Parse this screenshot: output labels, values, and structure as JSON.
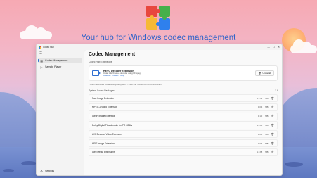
{
  "hero": {
    "title": "Your hub for Windows codec management"
  },
  "window": {
    "app_name": "Codec Hub",
    "controls": [
      "—",
      "☐",
      "✕"
    ]
  },
  "sidebar": {
    "items": [
      {
        "label": "Codec Management",
        "icon": "grid-icon",
        "active": true
      },
      {
        "label": "Sample Player",
        "icon": "play-icon",
        "active": false
      }
    ],
    "settings_label": "Settings"
  },
  "main": {
    "title": "Codec Management",
    "installed_label": "Codec Hub Extensions",
    "extension": {
      "name": "HEVC Decoder Extension",
      "desc": "Install HEVC video decoder using FFmpeg",
      "links": [
        "Available",
        "Details",
        "Help"
      ],
      "button_label": "Uninstall"
    },
    "note": "These codecs are installed on your system — click the TRASH icon to remove them",
    "system_label": "System Codec Packages",
    "codecs": [
      {
        "name": "Raw Image Extension",
        "version": "2.1.32",
        "size": "MB"
      },
      {
        "name": "MPEG-2 Video Extension",
        "version": "1.0.4",
        "size": "MB"
      },
      {
        "name": "WebP Image Extension",
        "version": "1.1.0",
        "size": "MB"
      },
      {
        "name": "Dolby Digital Plus decoder for PC OEMs",
        "version": "1.0.88",
        "size": "MB"
      },
      {
        "name": "AV1 Decoder Video Extension",
        "version": "1.2.0",
        "size": "MB"
      },
      {
        "name": "HEIF Image Extension",
        "version": "1.0.6",
        "size": "MB"
      },
      {
        "name": "Web Media Extensions",
        "version": "1.0.88",
        "size": "MB"
      }
    ]
  },
  "colors": {
    "accent": "#2f6fd1",
    "hero_text": "#2f63c8"
  }
}
